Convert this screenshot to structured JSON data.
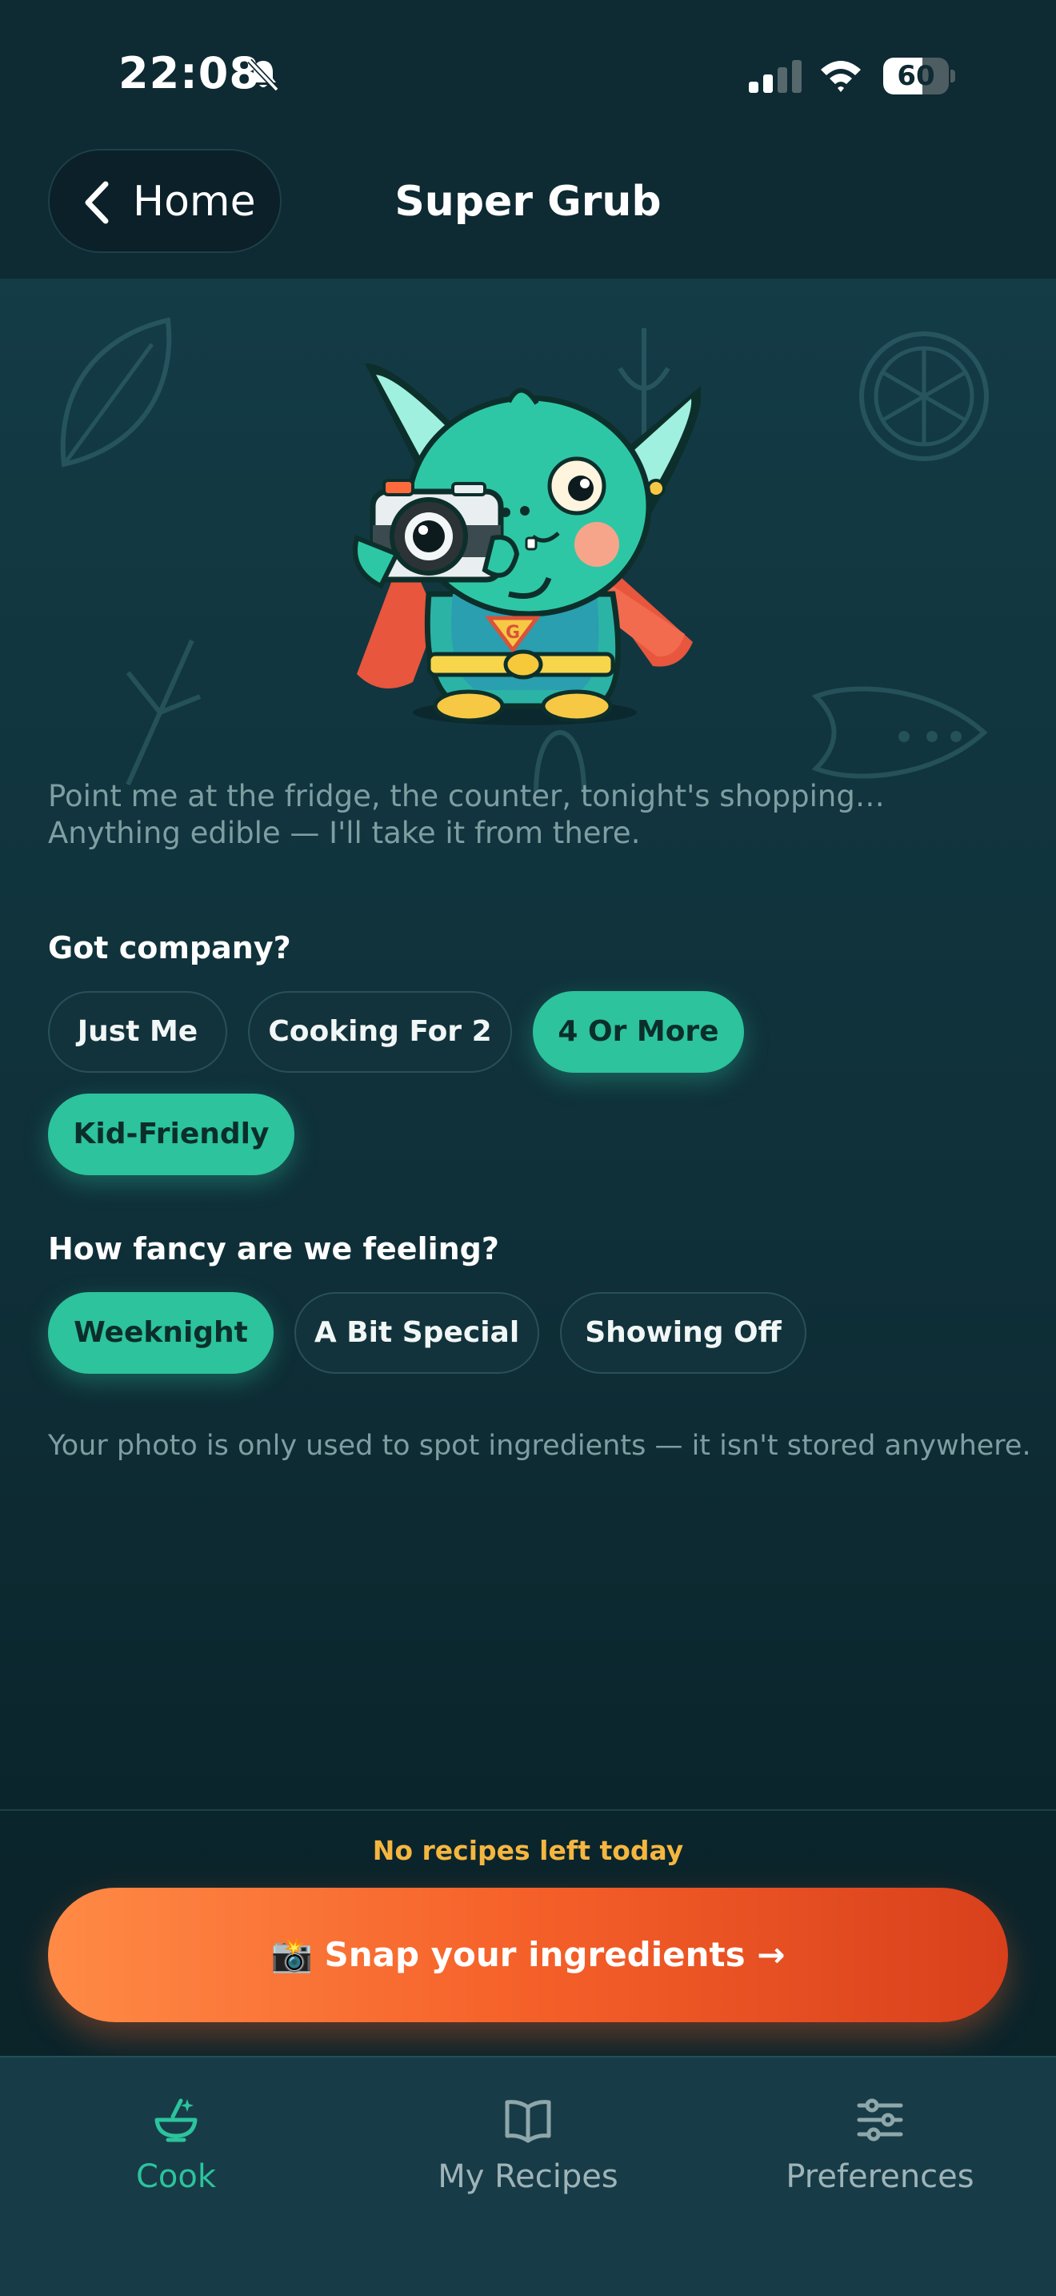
{
  "status_bar": {
    "time": "22:08",
    "battery": "60"
  },
  "header": {
    "back_label": "Home",
    "title": "Super Grub"
  },
  "intro_text": "Point me at the fridge, the counter, tonight's shopping… Anything edible — I'll take it from there.",
  "company": {
    "label": "Got company?",
    "options": [
      {
        "label": "Just Me",
        "selected": false
      },
      {
        "label": "Cooking For 2",
        "selected": false
      },
      {
        "label": "4 Or More",
        "selected": true
      },
      {
        "label": "Kid-Friendly",
        "selected": true
      }
    ]
  },
  "fancy": {
    "label": "How fancy are we feeling?",
    "options": [
      {
        "label": "Weeknight",
        "selected": true
      },
      {
        "label": "A Bit Special",
        "selected": false
      },
      {
        "label": "Showing Off",
        "selected": false
      }
    ]
  },
  "privacy_note": "Your photo is only used to spot ingredients — it isn't stored anywhere.",
  "limit_note": "No recipes left today",
  "cta_label": "📸 Snap your ingredients →",
  "tabs": [
    {
      "label": "Cook",
      "icon": "bowl-icon",
      "active": true
    },
    {
      "label": "My Recipes",
      "icon": "book-icon",
      "active": false
    },
    {
      "label": "Preferences",
      "icon": "sliders-icon",
      "active": false
    }
  ],
  "colors": {
    "accent": "#2cc39d",
    "cta_start": "#ff8a46",
    "cta_end": "#d8401c",
    "warning": "#f5b640"
  }
}
